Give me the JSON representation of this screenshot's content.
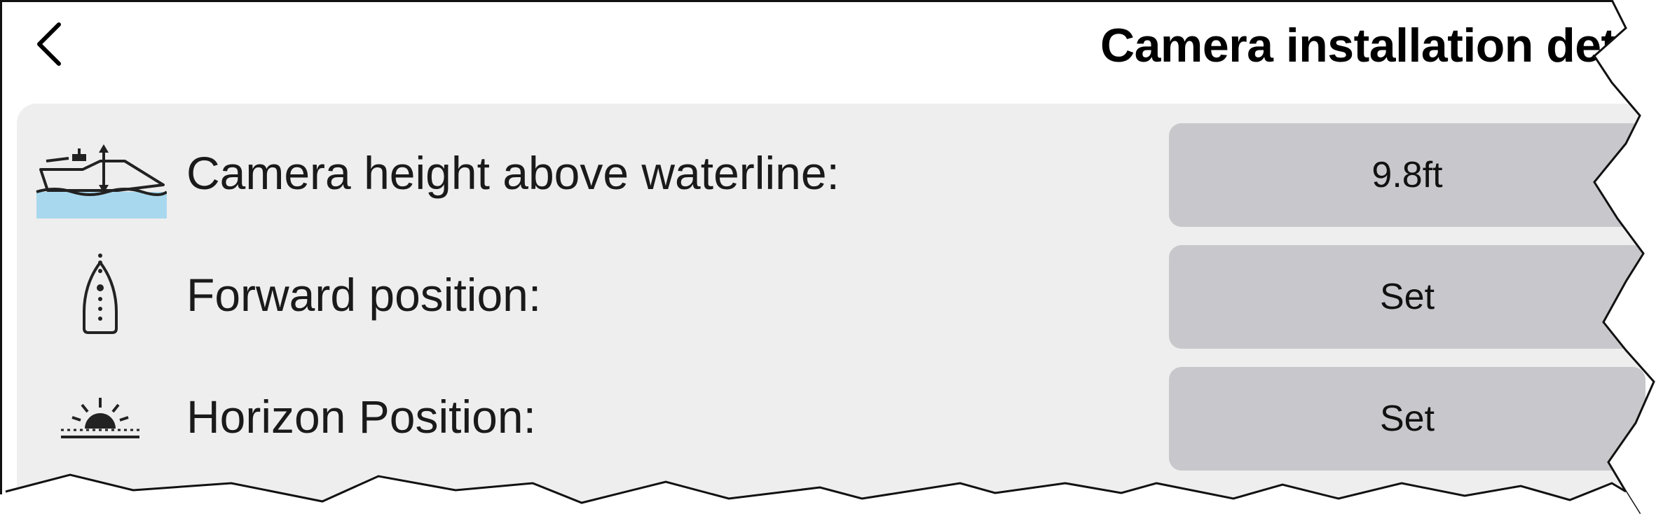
{
  "header": {
    "back_icon": "chevron-left-icon",
    "title": "Camera installation det"
  },
  "rows": [
    {
      "icon": "boat-height-icon",
      "label": "Camera height above waterline:",
      "value": "9.8ft"
    },
    {
      "icon": "boat-forward-icon",
      "label": "Forward position:",
      "value": "Set"
    },
    {
      "icon": "horizon-sunrise-icon",
      "label": "Horizon Position:",
      "value": "Set"
    }
  ],
  "colors": {
    "panel_background": "#eeeeee",
    "button_background": "#c8c8cc",
    "water": "#a8d8ee"
  }
}
